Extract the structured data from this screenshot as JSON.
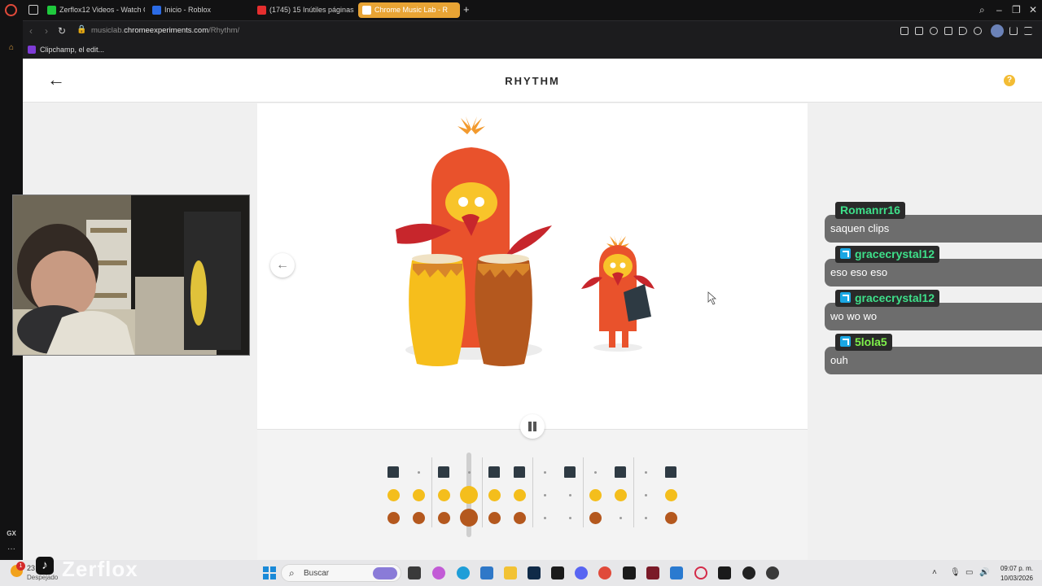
{
  "browser": {
    "tabs": [
      {
        "label": "Zerflox12 Videos - Watch C",
        "icon_color": "#1fc93d",
        "active": false
      },
      {
        "label": "Inicio - Roblox",
        "icon_color": "#2b6be6",
        "active": false
      },
      {
        "label": "(1745) 15 Inútiles páginas",
        "icon_color": "#e52e2e",
        "active": false
      },
      {
        "label": "Chrome Music Lab - R",
        "icon_color": "#ffffff",
        "active": true
      }
    ],
    "new_tab_label": "+",
    "url_prefix": "musiclab.",
    "url_domain": "chromeexperiments.com",
    "url_path": "/Rhythm/",
    "bookmark": "Clipchamp, el edit...",
    "sidebar_badge": "GX"
  },
  "page": {
    "title": "RHYTHM",
    "help_label": "?",
    "back_label": "←",
    "prev_label": "←"
  },
  "sequencer": {
    "instruments": [
      "bell",
      "conga-high",
      "conga-low"
    ],
    "colors": {
      "bell": "#2e3a43",
      "conga-high": "#f4be1c",
      "conga-low": "#b4581e"
    },
    "steps": 12,
    "playhead_step": 3,
    "pattern": {
      "bell": [
        1,
        0,
        1,
        0,
        1,
        1,
        0,
        1,
        0,
        1,
        0,
        1
      ],
      "conga-high": [
        1,
        1,
        1,
        1,
        1,
        1,
        0,
        0,
        1,
        1,
        0,
        1
      ],
      "conga-low": [
        1,
        1,
        1,
        1,
        1,
        1,
        0,
        0,
        1,
        0,
        0,
        1
      ]
    }
  },
  "chat": [
    {
      "user": "Romanrr16",
      "color": "#3ee08a",
      "mod": false,
      "message": "saquen clips"
    },
    {
      "user": "gracecrystal12",
      "color": "#3ee08a",
      "mod": true,
      "message": "eso eso eso"
    },
    {
      "user": "gracecrystal12",
      "color": "#3ee08a",
      "mod": true,
      "message": "wo wo wo"
    },
    {
      "user": "5lola5",
      "color": "#7ef04a",
      "mod": true,
      "message": "ouh"
    }
  ],
  "overlay": {
    "watermark_name": "Zerflox",
    "tiktok_glyph": "♪"
  },
  "taskbar": {
    "weather_temp": "23",
    "weather_desc": "Despejado",
    "notification_count": "1",
    "search_placeholder": "Buscar",
    "time": "09:07 p. m.",
    "date": "10/03/2026"
  }
}
